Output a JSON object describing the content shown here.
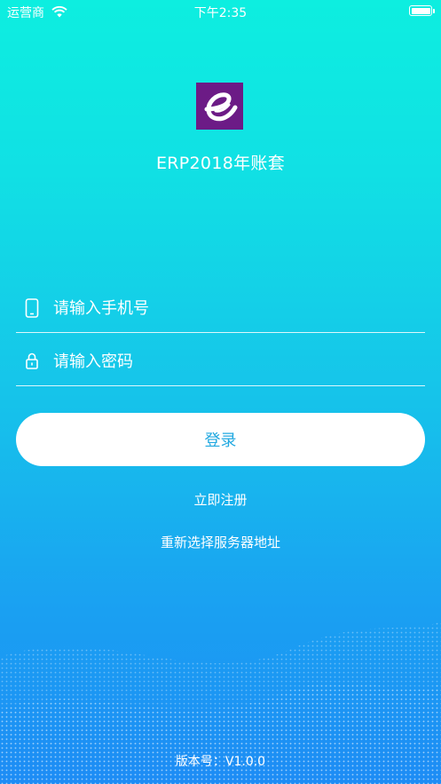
{
  "status_bar": {
    "carrier": "运营商",
    "time": "下午2:35"
  },
  "logo": {
    "icon": "e-logo-icon",
    "bg_color": "#6c1b86"
  },
  "app_title": "ERP2018年账套",
  "form": {
    "phone_placeholder": "请输入手机号",
    "password_placeholder": "请输入密码"
  },
  "actions": {
    "login": "登录",
    "register": "立即注册",
    "select_server": "重新选择服务器地址"
  },
  "version": "版本号：V1.0.0",
  "colors": {
    "gradient_top": "#0deee0",
    "gradient_bottom": "#1d8cf5",
    "button_text": "#20a8e0"
  }
}
